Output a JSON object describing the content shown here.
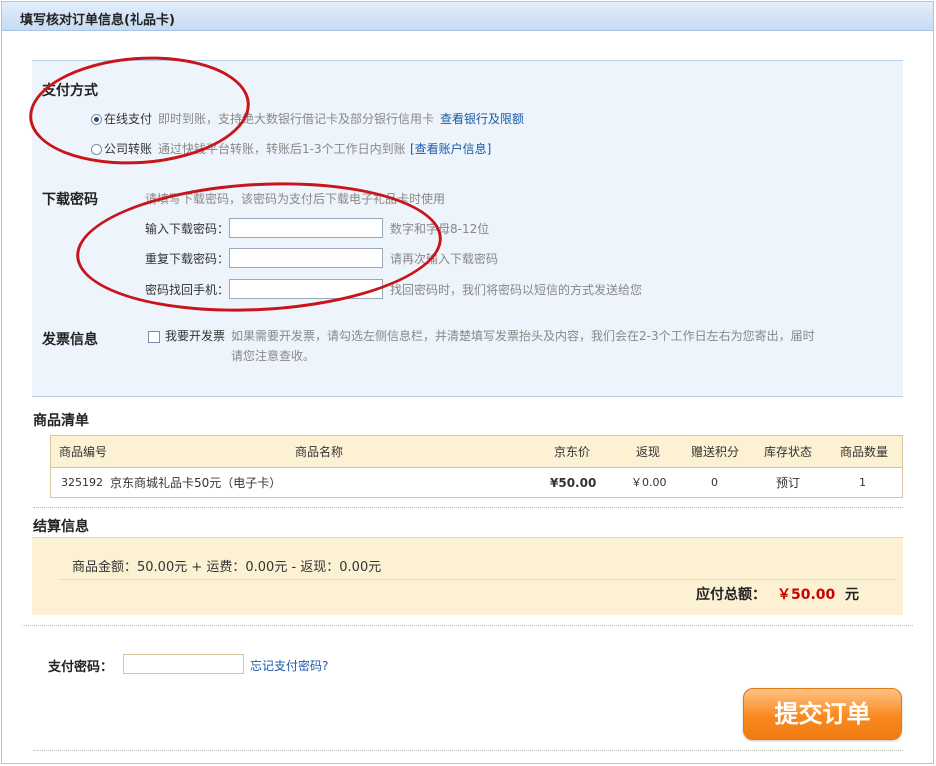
{
  "page": {
    "title": "填写核对订单信息(礼品卡)"
  },
  "payment": {
    "label": "支付方式",
    "options": [
      {
        "label": "在线支付",
        "desc": "即时到账，支持绝大数银行借记卡及部分银行信用卡",
        "link": "查看银行及限额",
        "selected": true
      },
      {
        "label": "公司转账",
        "desc": "通过快钱平台转账，转账后1-3个工作日内到账",
        "link": "[查看账户信息]",
        "selected": false
      }
    ]
  },
  "download_password": {
    "label": "下载密码",
    "hint": "请填写下载密码，该密码为支付后下载电子礼品卡时使用",
    "fields": [
      {
        "label": "输入下载密码：",
        "value": "",
        "tip": "数字和字母8-12位"
      },
      {
        "label": "重复下载密码：",
        "value": "",
        "tip": "请再次输入下载密码"
      },
      {
        "label": "密码找回手机：",
        "value": "",
        "tip": "找回密码时，我们将密码以短信的方式发送给您"
      }
    ]
  },
  "invoice": {
    "label": "发票信息",
    "checkbox_label": "我要开发票",
    "checked": false,
    "desc_line1": "如果需要开发票，请勾选左侧信息栏，并清楚填写发票抬头及内容，我们会在2-3个工作日左右为您寄出，届时",
    "desc_line2": "请您注意查收。"
  },
  "goods": {
    "label": "商品清单",
    "headers": [
      "商品编号",
      "商品名称",
      "京东价",
      "返现",
      "赠送积分",
      "库存状态",
      "商品数量"
    ],
    "rows": [
      {
        "id": "325192",
        "name": "京东商城礼品卡50元（电子卡）",
        "price": "¥50.00",
        "cashback": "￥0.00",
        "points": "0",
        "stock": "预订",
        "qty": "1"
      }
    ]
  },
  "settlement": {
    "label": "结算信息",
    "summary": "商品金额：50.00元 + 运费：0.00元 - 返现：0.00元",
    "total_label": "应付总额：",
    "total_value": "￥50.00",
    "total_unit": "元"
  },
  "pay_password": {
    "label": "支付密码：",
    "value": "",
    "forgot_link": "忘记支付密码?"
  },
  "submit": {
    "label": "提交订单"
  },
  "colors": {
    "accent_link": "#1a5aa8",
    "total_red": "#cc0000",
    "annotation_red": "#c8151b",
    "button_orange": "#f98a1f"
  }
}
